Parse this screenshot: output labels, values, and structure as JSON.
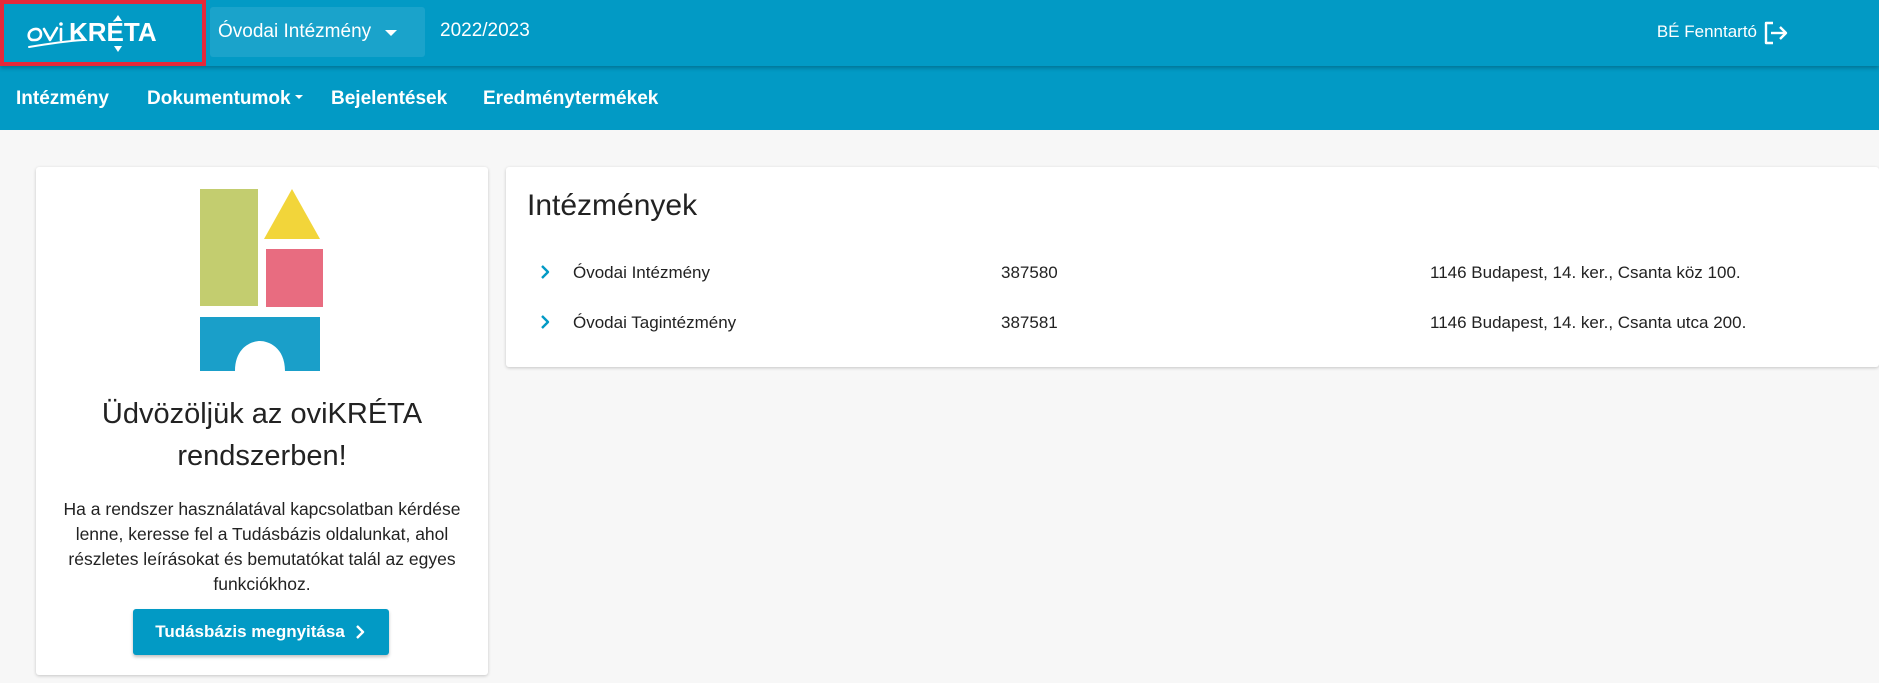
{
  "header": {
    "logo_text": "oviKRÉTA",
    "institution_selected": "Óvodai Intézmény",
    "school_year": "2022/2023",
    "user_name": "BÉ Fenntartó",
    "icons": {
      "logout": "logout-icon",
      "dropdown": "chevron-down-icon"
    },
    "colors": {
      "primary": "#029ac5",
      "highlight": "#e5283a"
    }
  },
  "nav": {
    "items": [
      {
        "label": "Intézmény"
      },
      {
        "label": "Dokumentumok",
        "has_dropdown": true
      },
      {
        "label": "Bejelentések"
      },
      {
        "label": "Eredménytermékek"
      }
    ]
  },
  "welcome": {
    "title": "Üdvözöljük az oviKRÉTA rendszerben!",
    "text": "Ha a rendszer használatával kapcsolatban kérdése lenne, keresse fel a Tudásbázis oldalunkat, ahol részletes leírásokat és bemutatókat talál az egyes funkciókhoz.",
    "button_label": "Tudásbázis megnyitása",
    "block_colors": {
      "green": "#c3cd6f",
      "yellow": "#f2d53a",
      "pink": "#e86c80",
      "blue": "#1a9fc9"
    }
  },
  "institutions": {
    "title": "Intézmények",
    "rows": [
      {
        "name": "Óvodai Intézmény",
        "code": "387580",
        "address": "1146 Budapest, 14. ker., Csanta köz 100."
      },
      {
        "name": "Óvodai Tagintézmény",
        "code": "387581",
        "address": "1146 Budapest, 14. ker., Csanta utca 200."
      }
    ]
  }
}
